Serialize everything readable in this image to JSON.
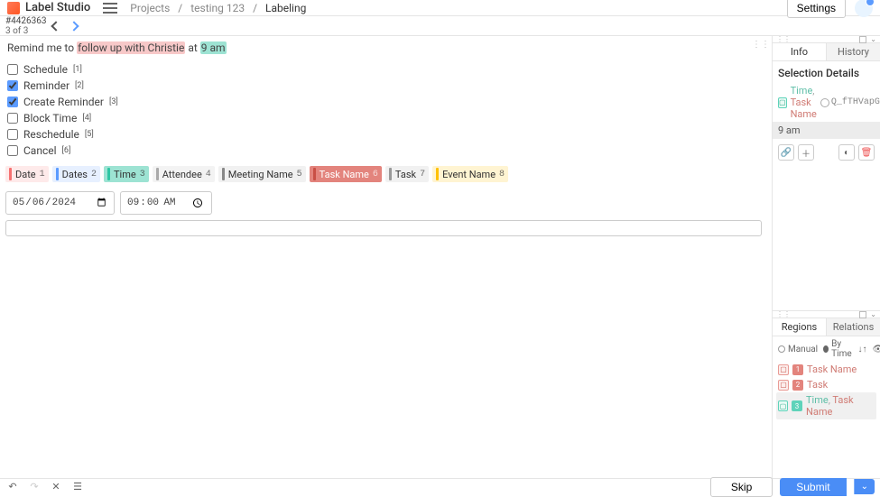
{
  "brand": "Label Studio",
  "breadcrumb": {
    "a": "Projects",
    "b": "testing 123",
    "c": "Labeling"
  },
  "settings_label": "Settings",
  "task": {
    "id": "#4426363",
    "pos": "3 of 3"
  },
  "sentence": {
    "pre": "Remind me to ",
    "span1": "follow up with Christie",
    "mid": " at ",
    "span2": "9 am"
  },
  "checks": [
    {
      "label": "Schedule",
      "sup": "[1]",
      "checked": false
    },
    {
      "label": "Reminder",
      "sup": "[2]",
      "checked": true
    },
    {
      "label": "Create Reminder",
      "sup": "[3]",
      "checked": true
    },
    {
      "label": "Block Time",
      "sup": "[4]",
      "checked": false
    },
    {
      "label": "Reschedule",
      "sup": "[5]",
      "checked": false
    },
    {
      "label": "Cancel",
      "sup": "[6]",
      "checked": false
    }
  ],
  "labels": [
    {
      "cls": "date",
      "name": "Date",
      "key": "1"
    },
    {
      "cls": "dates",
      "name": "Dates",
      "key": "2"
    },
    {
      "cls": "time",
      "name": "Time",
      "key": "3"
    },
    {
      "cls": "att",
      "name": "Attendee",
      "key": "4"
    },
    {
      "cls": "mname",
      "name": "Meeting Name",
      "key": "5"
    },
    {
      "cls": "tname",
      "name": "Task Name",
      "key": "6"
    },
    {
      "cls": "task",
      "name": "Task",
      "key": "7"
    },
    {
      "cls": "ename",
      "name": "Event Name",
      "key": "8"
    }
  ],
  "date_value": "2024-05-06",
  "time_value": "09:00",
  "side": {
    "tab_info": "Info",
    "tab_history": "History",
    "sel_title": "Selection Details",
    "sel_label_a": "Time",
    "sel_sep": ", ",
    "sel_label_b": "Task Name",
    "sel_id": "Q_fTHVapGV",
    "sel_text": "9 am",
    "tab_regions": "Regions",
    "tab_relations": "Relations",
    "sort_manual": "Manual",
    "sort_bytime": "By Time",
    "regions": [
      {
        "n": "1",
        "cls": "pink",
        "label": "Task Name"
      },
      {
        "n": "2",
        "cls": "pink",
        "label": "Task"
      },
      {
        "n": "3",
        "cls": "teal",
        "label_a": "Time",
        "label_b": "Task Name",
        "sel": true
      }
    ]
  },
  "footer": {
    "skip": "Skip",
    "submit": "Submit"
  }
}
